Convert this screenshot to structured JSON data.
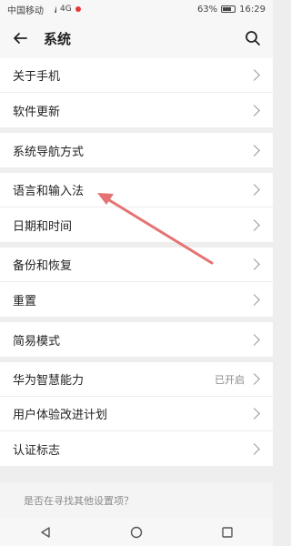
{
  "status": {
    "carrier": "中国移动",
    "network": "4G",
    "battery": "63%",
    "time": "16:29"
  },
  "appbar": {
    "title": "系统"
  },
  "groups": [
    [
      {
        "label": "关于手机"
      },
      {
        "label": "软件更新"
      }
    ],
    [
      {
        "label": "系统导航方式"
      }
    ],
    [
      {
        "label": "语言和输入法"
      },
      {
        "label": "日期和时间"
      }
    ],
    [
      {
        "label": "备份和恢复"
      },
      {
        "label": "重置"
      }
    ],
    [
      {
        "label": "简易模式"
      }
    ],
    [
      {
        "label": "华为智慧能力",
        "value": "已开启"
      },
      {
        "label": "用户体验改进计划"
      },
      {
        "label": "认证标志"
      }
    ]
  ],
  "suggest": {
    "text": "是否在寻找其他设置项？"
  },
  "colors": {
    "accent_arrow": "#e57373"
  }
}
